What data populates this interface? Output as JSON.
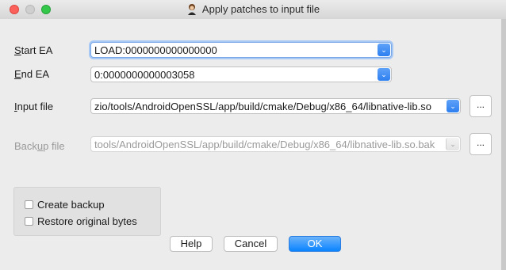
{
  "window": {
    "title": "Apply patches to input file"
  },
  "fields": {
    "start_ea": {
      "label_u": "S",
      "label_rest": "tart EA",
      "value": "LOAD:0000000000000000"
    },
    "end_ea": {
      "label_u": "E",
      "label_rest": "nd EA",
      "value": "0:0000000000003058"
    },
    "input_file": {
      "label_u": "I",
      "label_rest": "nput file",
      "value": "zio/tools/AndroidOpenSSL/app/build/cmake/Debug/x86_64/libnative-lib.so",
      "browse": "..."
    },
    "backup_file": {
      "label_pre": "Back",
      "label_u": "u",
      "label_rest": "p file",
      "value": "tools/AndroidOpenSSL/app/build/cmake/Debug/x86_64/libnative-lib.so.bak",
      "browse": "..."
    }
  },
  "options": {
    "create_backup": "Create backup",
    "restore_original": "Restore original bytes"
  },
  "buttons": {
    "help": "Help",
    "cancel": "Cancel",
    "ok": "OK"
  },
  "colors": {
    "accent": "#0a84ff",
    "close": "#fc605b",
    "maximize": "#34c84a"
  },
  "icons": {
    "app": "ida-icon",
    "dropdown": "chevron-down-icon"
  }
}
